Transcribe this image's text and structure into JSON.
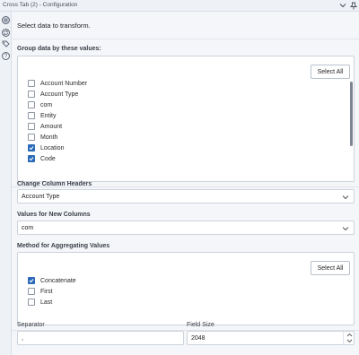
{
  "window": {
    "title": "Cross Tab (2) - Configuration",
    "chevron_icon": "chevron-down-icon",
    "pin_icon": "pin-icon"
  },
  "sidebar": {
    "icons": [
      "gear-icon",
      "sync-icon",
      "tag-icon",
      "help-icon"
    ]
  },
  "main": {
    "lead": "Select data to transform.",
    "group": {
      "label": "Group data by these values:",
      "select_all": "Select All",
      "items": [
        {
          "label": "Account Number",
          "checked": false
        },
        {
          "label": "Account Type",
          "checked": false
        },
        {
          "label": "com",
          "checked": false
        },
        {
          "label": "Entity",
          "checked": false
        },
        {
          "label": "Amount",
          "checked": false
        },
        {
          "label": "Month",
          "checked": false
        },
        {
          "label": "Location",
          "checked": true
        },
        {
          "label": "Code",
          "checked": true
        }
      ]
    },
    "change_headers": {
      "label": "Change Column Headers",
      "value": "Account Type"
    },
    "values_new": {
      "label": "Values for New Columns",
      "value": "com"
    },
    "aggregation": {
      "label": "Method for Aggregating Values",
      "select_all": "Select All",
      "items": [
        {
          "label": "Concatenate",
          "checked": true
        },
        {
          "label": "First",
          "checked": false
        },
        {
          "label": "Last",
          "checked": false
        }
      ]
    },
    "separator": {
      "label": "Separator",
      "value": ","
    },
    "field_size": {
      "label": "Field Size",
      "value": "2048"
    }
  },
  "colors": {
    "accent": "#2a6ab8",
    "panel_border": "#cdd3dc",
    "background": "#f4f6fa"
  }
}
